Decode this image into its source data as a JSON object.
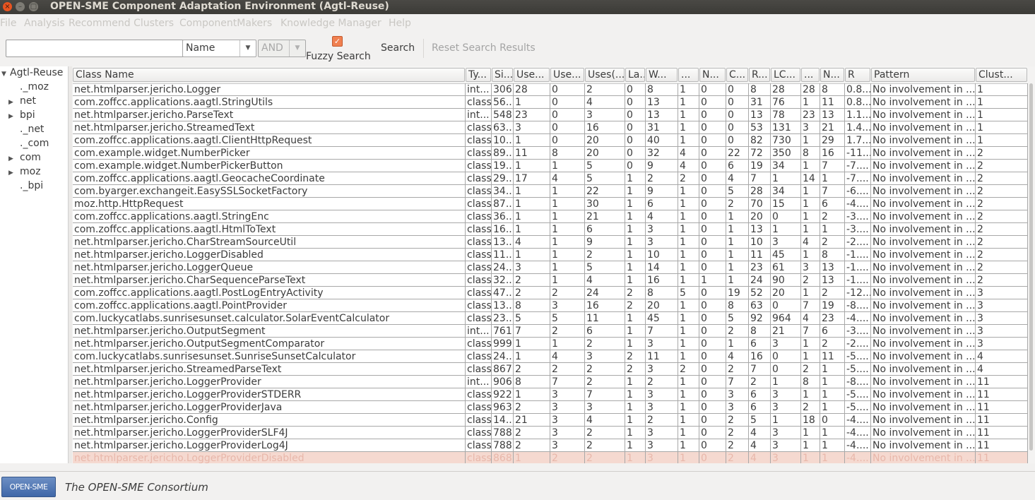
{
  "window": {
    "title": "OPEN-SME Component Adaptation Environment (Agtl-Reuse)",
    "buttons": {
      "close": "×",
      "minimize": "–",
      "maximize": "□"
    }
  },
  "menu": [
    "File",
    "Analysis",
    "Recommend Clusters",
    "ComponentMakers",
    "Knowledge Manager",
    "Help"
  ],
  "toolbar": {
    "search_value": "",
    "field_combo": "Name",
    "operator_combo": "AND",
    "fuzzy_label": "Fuzzy Search",
    "fuzzy_checked": true,
    "search_button": "Search",
    "reset_button": "Reset Search Results"
  },
  "tree": {
    "root": "Agtl-Reuse",
    "children": [
      {
        "label": "._moz",
        "expandable": false
      },
      {
        "label": "net",
        "expandable": true
      },
      {
        "label": "bpi",
        "expandable": true
      },
      {
        "label": "._net",
        "expandable": false
      },
      {
        "label": "._com",
        "expandable": false
      },
      {
        "label": "com",
        "expandable": true
      },
      {
        "label": "moz",
        "expandable": true
      },
      {
        "label": "._bpi",
        "expandable": false
      }
    ]
  },
  "table": {
    "columns": [
      "Class Name",
      "Ty...",
      "Si...",
      "Use...",
      "Use...",
      "Uses(...",
      "La...",
      "W...",
      "...",
      "N...",
      "C...",
      "R...",
      "LC...",
      "...",
      "N...",
      "R",
      "Pattern",
      "Clust..."
    ],
    "sorted_column": 17,
    "selected_row": 29,
    "rows": [
      [
        "net.htmlparser.jericho.Logger",
        "int...",
        "306",
        "28",
        "0",
        "2",
        "0",
        "8",
        "1",
        "0",
        "0",
        "8",
        "28",
        "28",
        "8",
        "0.8...",
        "No involvement in ...",
        "1"
      ],
      [
        "com.zoffcc.applications.aagtl.StringUtils",
        "class",
        "56...",
        "1",
        "0",
        "4",
        "0",
        "13",
        "1",
        "0",
        "0",
        "31",
        "76",
        "1",
        "11",
        "0.8...",
        "No involvement in ...",
        "1"
      ],
      [
        "net.htmlparser.jericho.ParseText",
        "int...",
        "548",
        "23",
        "0",
        "3",
        "0",
        "13",
        "1",
        "0",
        "0",
        "13",
        "78",
        "23",
        "13",
        "1.1...",
        "No involvement in ...",
        "1"
      ],
      [
        "net.htmlparser.jericho.StreamedText",
        "class",
        "63...",
        "3",
        "0",
        "16",
        "0",
        "31",
        "1",
        "0",
        "0",
        "53",
        "131",
        "3",
        "21",
        "1.4...",
        "No involvement in ...",
        "1"
      ],
      [
        "com.zoffcc.applications.aagtl.ClientHttpRequest",
        "class",
        "10...",
        "1",
        "0",
        "20",
        "0",
        "40",
        "1",
        "0",
        "0",
        "82",
        "730",
        "1",
        "29",
        "1.7...",
        "No involvement in ...",
        "1"
      ],
      [
        "com.example.widget.NumberPicker",
        "class",
        "89...",
        "11",
        "8",
        "20",
        "0",
        "32",
        "4",
        "0",
        "22",
        "72",
        "350",
        "8",
        "16",
        "-11...",
        "No involvement in ...",
        "2"
      ],
      [
        "com.example.widget.NumberPickerButton",
        "class",
        "19...",
        "1",
        "1",
        "5",
        "0",
        "9",
        "4",
        "0",
        "6",
        "19",
        "34",
        "1",
        "7",
        "-7....",
        "No involvement in ...",
        "2"
      ],
      [
        "com.zoffcc.applications.aagtl.GeocacheCoordinate",
        "class",
        "29...",
        "17",
        "4",
        "5",
        "1",
        "2",
        "2",
        "0",
        "4",
        "7",
        "1",
        "14",
        "1",
        "-7....",
        "No involvement in ...",
        "2"
      ],
      [
        "com.byarger.exchangeit.EasySSLSocketFactory",
        "class",
        "34...",
        "1",
        "1",
        "22",
        "1",
        "9",
        "1",
        "0",
        "5",
        "28",
        "34",
        "1",
        "7",
        "-6....",
        "No involvement in ...",
        "2"
      ],
      [
        "moz.http.HttpRequest",
        "class",
        "87...",
        "1",
        "1",
        "30",
        "1",
        "6",
        "1",
        "0",
        "2",
        "70",
        "15",
        "1",
        "6",
        "-4....",
        "No involvement in ...",
        "2"
      ],
      [
        "com.zoffcc.applications.aagtl.StringEnc",
        "class",
        "36...",
        "1",
        "1",
        "21",
        "1",
        "4",
        "1",
        "0",
        "1",
        "20",
        "0",
        "1",
        "2",
        "-3....",
        "No involvement in ...",
        "2"
      ],
      [
        "com.zoffcc.applications.aagtl.HtmlToText",
        "class",
        "16...",
        "1",
        "1",
        "6",
        "1",
        "3",
        "1",
        "0",
        "1",
        "13",
        "1",
        "1",
        "1",
        "-3....",
        "No involvement in ...",
        "2"
      ],
      [
        "net.htmlparser.jericho.CharStreamSourceUtil",
        "class",
        "13...",
        "4",
        "1",
        "9",
        "1",
        "3",
        "1",
        "0",
        "1",
        "10",
        "3",
        "4",
        "2",
        "-2....",
        "No involvement in ...",
        "2"
      ],
      [
        "net.htmlparser.jericho.LoggerDisabled",
        "class",
        "11...",
        "1",
        "1",
        "2",
        "1",
        "10",
        "1",
        "0",
        "1",
        "11",
        "45",
        "1",
        "8",
        "-1....",
        "No involvement in ...",
        "2"
      ],
      [
        "net.htmlparser.jericho.LoggerQueue",
        "class",
        "24...",
        "3",
        "1",
        "5",
        "1",
        "14",
        "1",
        "0",
        "1",
        "23",
        "61",
        "3",
        "13",
        "-1....",
        "No involvement in ...",
        "2"
      ],
      [
        "net.htmlparser.jericho.CharSequenceParseText",
        "class",
        "32...",
        "2",
        "1",
        "4",
        "1",
        "16",
        "1",
        "1",
        "1",
        "24",
        "90",
        "2",
        "13",
        "-1....",
        "No involvement in ...",
        "2"
      ],
      [
        "com.zoffcc.applications.aagtl.PostLogEntryActivity",
        "class",
        "47...",
        "2",
        "2",
        "24",
        "2",
        "8",
        "5",
        "0",
        "19",
        "52",
        "20",
        "1",
        "2",
        "-12...",
        "No involvement in ...",
        "3"
      ],
      [
        "com.zoffcc.applications.aagtl.PointProvider",
        "class",
        "13...",
        "8",
        "3",
        "16",
        "2",
        "20",
        "1",
        "0",
        "8",
        "63",
        "0",
        "7",
        "19",
        "-8....",
        "No involvement in ...",
        "3"
      ],
      [
        "com.luckycatlabs.sunrisesunset.calculator.SolarEventCalculator",
        "class",
        "23...",
        "5",
        "5",
        "11",
        "1",
        "45",
        "1",
        "0",
        "5",
        "92",
        "964",
        "4",
        "23",
        "-4....",
        "No involvement in ...",
        "3"
      ],
      [
        "net.htmlparser.jericho.OutputSegment",
        "int...",
        "761",
        "7",
        "2",
        "6",
        "1",
        "7",
        "1",
        "0",
        "2",
        "8",
        "21",
        "7",
        "6",
        "-3....",
        "No involvement in ...",
        "3"
      ],
      [
        "net.htmlparser.jericho.OutputSegmentComparator",
        "class",
        "999",
        "1",
        "1",
        "2",
        "1",
        "3",
        "1",
        "0",
        "1",
        "6",
        "3",
        "1",
        "2",
        "-2....",
        "No involvement in ...",
        "3"
      ],
      [
        "com.luckycatlabs.sunrisesunset.SunriseSunsetCalculator",
        "class",
        "24...",
        "1",
        "4",
        "3",
        "2",
        "11",
        "1",
        "0",
        "4",
        "16",
        "0",
        "1",
        "11",
        "-5....",
        "No involvement in ...",
        "4"
      ],
      [
        "net.htmlparser.jericho.StreamedParseText",
        "class",
        "867",
        "2",
        "2",
        "2",
        "2",
        "3",
        "2",
        "0",
        "2",
        "7",
        "0",
        "2",
        "1",
        "-5....",
        "No involvement in ...",
        "4"
      ],
      [
        "net.htmlparser.jericho.LoggerProvider",
        "int...",
        "906",
        "8",
        "7",
        "2",
        "1",
        "2",
        "1",
        "0",
        "7",
        "2",
        "1",
        "8",
        "1",
        "-8....",
        "No involvement in ...",
        "11"
      ],
      [
        "net.htmlparser.jericho.LoggerProviderSTDERR",
        "class",
        "922",
        "1",
        "3",
        "7",
        "1",
        "3",
        "1",
        "0",
        "3",
        "6",
        "3",
        "1",
        "1",
        "-5....",
        "No involvement in ...",
        "11"
      ],
      [
        "net.htmlparser.jericho.LoggerProviderJava",
        "class",
        "963",
        "2",
        "3",
        "3",
        "1",
        "3",
        "1",
        "0",
        "3",
        "6",
        "3",
        "2",
        "1",
        "-5....",
        "No involvement in ...",
        "11"
      ],
      [
        "net.htmlparser.jericho.Config",
        "class",
        "14...",
        "21",
        "3",
        "4",
        "1",
        "2",
        "1",
        "0",
        "2",
        "5",
        "1",
        "18",
        "0",
        "-4....",
        "No involvement in ...",
        "11"
      ],
      [
        "net.htmlparser.jericho.LoggerProviderSLF4J",
        "class",
        "788",
        "2",
        "3",
        "2",
        "1",
        "3",
        "1",
        "0",
        "2",
        "4",
        "3",
        "1",
        "1",
        "-4....",
        "No involvement in ...",
        "11"
      ],
      [
        "net.htmlparser.jericho.LoggerProviderLog4J",
        "class",
        "788",
        "2",
        "3",
        "2",
        "1",
        "3",
        "1",
        "0",
        "2",
        "4",
        "3",
        "1",
        "1",
        "-4....",
        "No involvement in ...",
        "11"
      ],
      [
        "net.htmlparser.jericho.LoggerProviderDisabled",
        "class",
        "868",
        "1",
        "2",
        "2",
        "1",
        "3",
        "1",
        "0",
        "2",
        "4",
        "3",
        "1",
        "1",
        "-4....",
        "No involvement in ...",
        "11"
      ]
    ]
  },
  "footer": {
    "logo": "OPEN-SME",
    "text": "The OPEN-SME Consortium"
  },
  "colors": {
    "titlebar": "#3c3b37",
    "close_button": "#e95420",
    "selected_row": "#f5d9d0",
    "checkbox": "#f08050"
  }
}
